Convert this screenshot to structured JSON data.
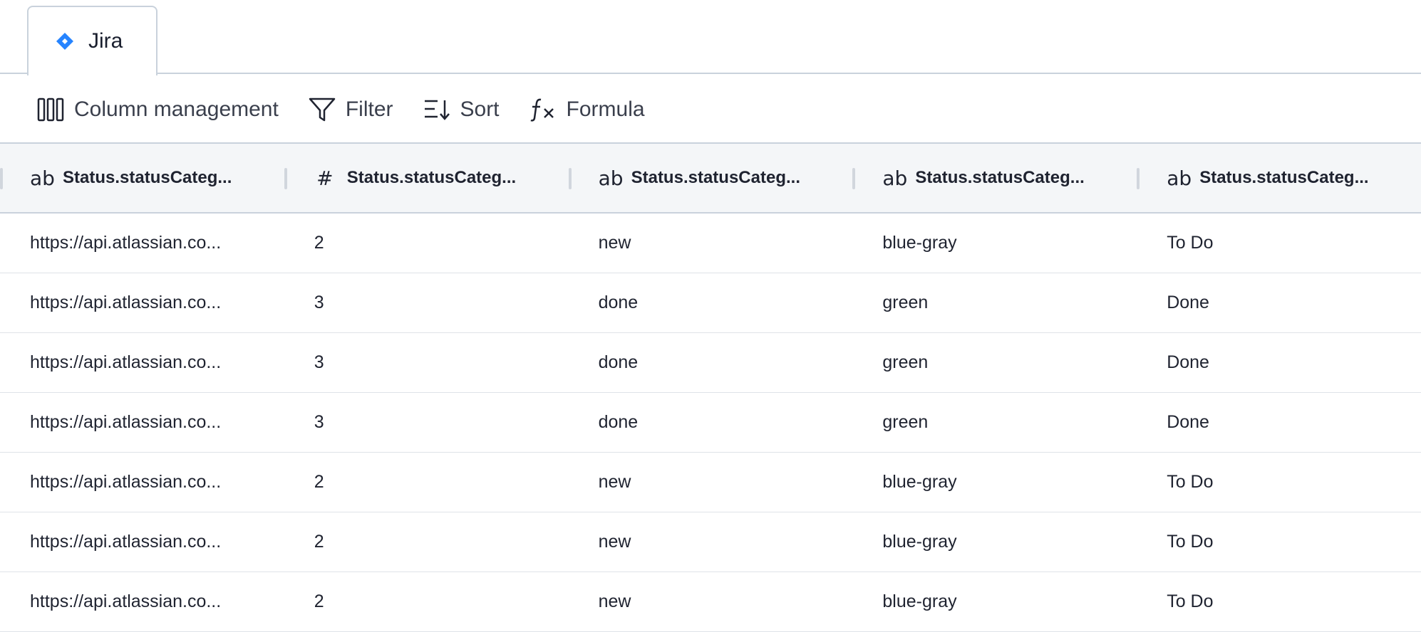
{
  "tab": {
    "label": "Jira",
    "icon": "jira-diamond-icon",
    "icon_color": "#2684ff"
  },
  "toolbar": {
    "column_management": "Column management",
    "filter": "Filter",
    "sort": "Sort",
    "formula": "Formula"
  },
  "columns": [
    {
      "type_glyph": "ab",
      "label": "Status.statusCateg..."
    },
    {
      "type_glyph": "#",
      "label": "Status.statusCateg..."
    },
    {
      "type_glyph": "ab",
      "label": "Status.statusCateg..."
    },
    {
      "type_glyph": "ab",
      "label": "Status.statusCateg..."
    },
    {
      "type_glyph": "ab",
      "label": "Status.statusCateg..."
    }
  ],
  "rows": [
    [
      "https://api.atlassian.co...",
      "2",
      "new",
      "blue-gray",
      "To Do"
    ],
    [
      "https://api.atlassian.co...",
      "3",
      "done",
      "green",
      "Done"
    ],
    [
      "https://api.atlassian.co...",
      "3",
      "done",
      "green",
      "Done"
    ],
    [
      "https://api.atlassian.co...",
      "3",
      "done",
      "green",
      "Done"
    ],
    [
      "https://api.atlassian.co...",
      "2",
      "new",
      "blue-gray",
      "To Do"
    ],
    [
      "https://api.atlassian.co...",
      "2",
      "new",
      "blue-gray",
      "To Do"
    ],
    [
      "https://api.atlassian.co...",
      "2",
      "new",
      "blue-gray",
      "To Do"
    ]
  ]
}
